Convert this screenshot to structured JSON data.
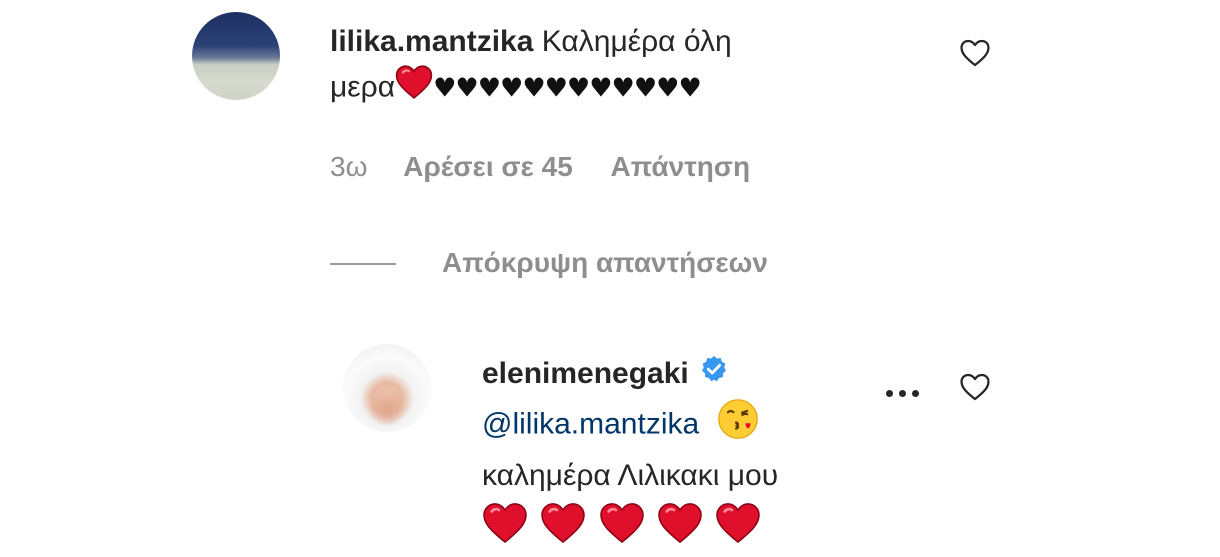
{
  "comment1": {
    "username": "lilika.mantzika",
    "text_line1": "Καλημέρα όλη",
    "text_line2": "μερα",
    "black_hearts": "♥♥♥♥♥♥♥♥♥♥♥♥",
    "time": "3ω",
    "likes": "Αρέσει σε 45",
    "reply": "Απάντηση"
  },
  "hide_replies": "Απόκρυψη απαντήσεων",
  "comment2": {
    "username": "elenimenegaki",
    "verified": true,
    "mention": "@lilika.mantzika",
    "text": "καλημέρα Λιλικακι μου",
    "red_heart_count": 5,
    "emoji": "kiss-face-icon"
  },
  "colors": {
    "text": "#262626",
    "meta": "#8e8e8e",
    "mention": "#003569",
    "verified": "#3897f0",
    "heart": "#e0102c"
  }
}
